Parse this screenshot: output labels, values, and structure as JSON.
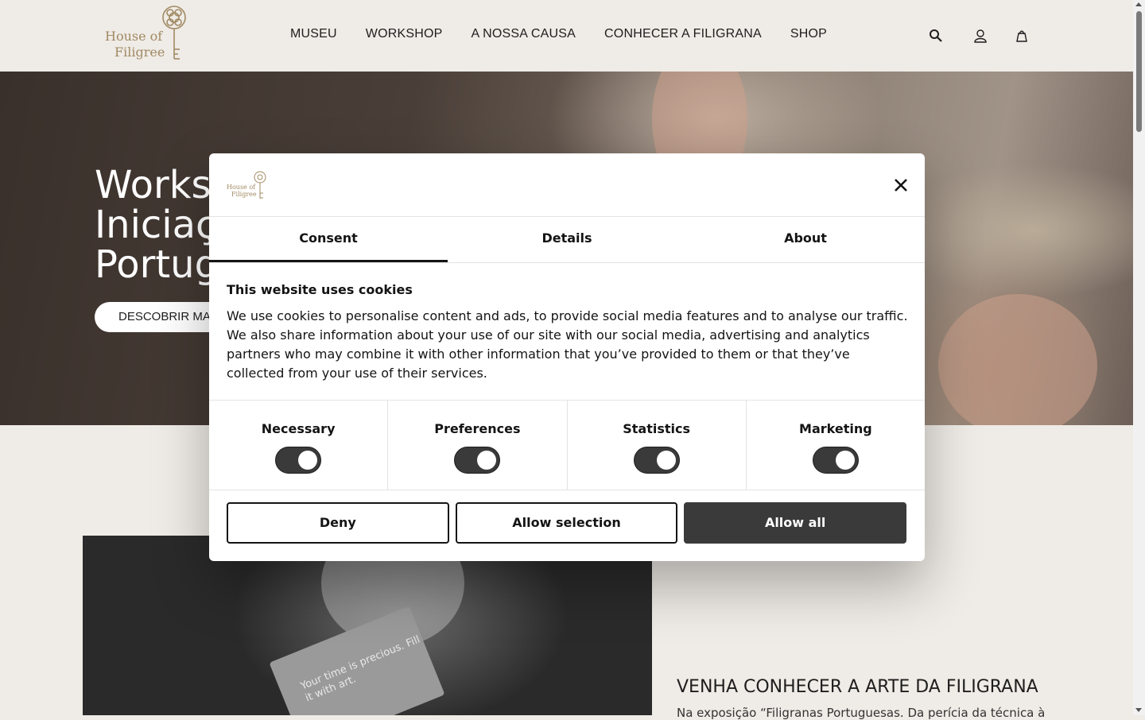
{
  "brand": {
    "line1": "House of",
    "line2": "Filigree"
  },
  "nav": {
    "items": [
      "MUSEU",
      "WORKSHOP",
      "A NOSSA CAUSA",
      "CONHECER A FILIGRANA",
      "SHOP"
    ]
  },
  "header_icons": [
    "search-icon",
    "account-icon",
    "bag-icon"
  ],
  "hero": {
    "title_lines": [
      "Works",
      "Iniciaç",
      "Portug"
    ],
    "button_label": "DESCOBRIR MA"
  },
  "section": {
    "card_text": "Your time is precious. Fill it with art.",
    "title": "VENHA CONHECER A ARTE DA FILIGRANA",
    "text": "Na exposição “Filigranas Portuguesas. Da perícia da técnica à"
  },
  "cookie_dialog": {
    "tabs": [
      {
        "label": "Consent",
        "active": true
      },
      {
        "label": "Details",
        "active": false
      },
      {
        "label": "About",
        "active": false
      }
    ],
    "title": "This website uses cookies",
    "body": "We use cookies to personalise content and ads, to provide social media features and to analyse our traffic. We also share information about your use of our site with our social media, advertising and analytics partners who may combine it with other information that you’ve provided to them or that they’ve collected from your use of their services.",
    "toggles": [
      {
        "label": "Necessary",
        "on": true
      },
      {
        "label": "Preferences",
        "on": true
      },
      {
        "label": "Statistics",
        "on": true
      },
      {
        "label": "Marketing",
        "on": true
      }
    ],
    "buttons": {
      "deny": "Deny",
      "allow_selection": "Allow selection",
      "allow_all": "Allow all"
    }
  },
  "colors": {
    "brand_gold": "#a08a63",
    "page_bg": "#efebe6",
    "dark_button": "#3a3a3a"
  }
}
